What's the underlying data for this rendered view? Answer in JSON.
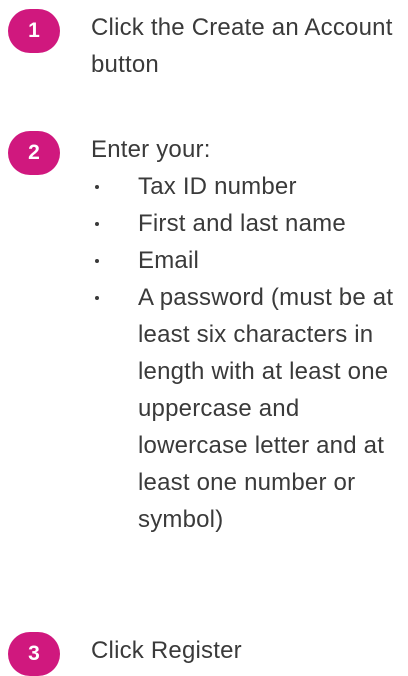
{
  "steps": [
    {
      "number": "1",
      "text": "Click the Create an Account button"
    },
    {
      "number": "2",
      "text": "Enter your:",
      "bullets": [
        "Tax ID number",
        "First and last name",
        "Email",
        "A password (must be at least six characters in length with at least one uppercase and lowercase letter and at least one number or symbol)"
      ]
    },
    {
      "number": "3",
      "text": "Click Register"
    }
  ],
  "colors": {
    "accent": "#d0187e",
    "text": "#3a3a3a"
  }
}
